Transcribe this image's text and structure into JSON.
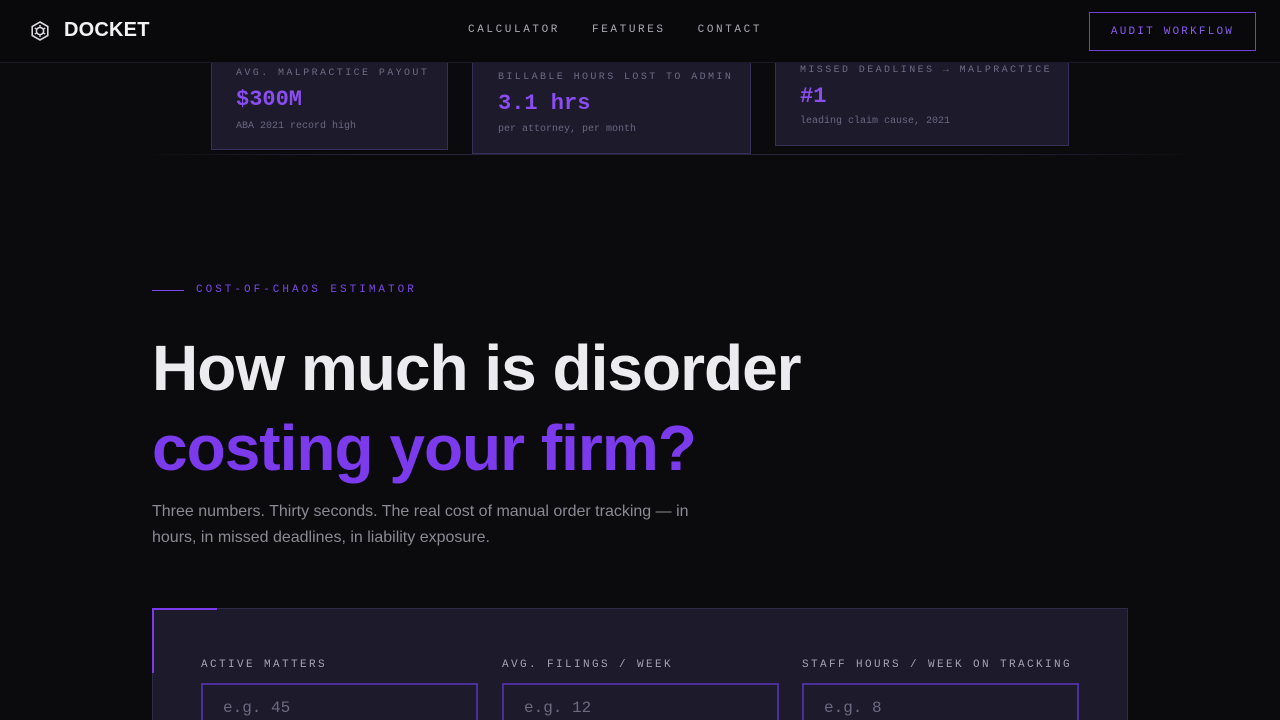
{
  "nav": {
    "brand": "DOCKET",
    "brand_icon": "gear-logo-icon",
    "links": [
      "CALCULATOR",
      "FEATURES",
      "CONTACT"
    ],
    "cta": "AUDIT WORKFLOW"
  },
  "stats": [
    {
      "label": "AVG. MALPRACTICE PAYOUT",
      "value": "$300M",
      "sub": "ABA 2021 record high"
    },
    {
      "label": "BILLABLE HOURS LOST TO ADMIN",
      "value": "3.1 hrs",
      "sub": "per attorney, per month"
    },
    {
      "label": "MISSED DEADLINES → MALPRACTICE",
      "value": "#1",
      "sub": "leading claim cause, 2021"
    }
  ],
  "hero": {
    "eyebrow": "COST-OF-CHAOS ESTIMATOR",
    "title_line1": "How much is disorder",
    "title_line2": "costing your firm?",
    "lead": "Three numbers. Thirty seconds. The real cost of manual order tracking — in hours, in missed deadlines, in liability exposure."
  },
  "calculator": {
    "fields": [
      {
        "label": "ACTIVE MATTERS",
        "placeholder": "e.g. 45",
        "value": ""
      },
      {
        "label": "AVG. FILINGS / WEEK",
        "placeholder": "e.g. 12",
        "value": ""
      },
      {
        "label": "STAFF HOURS / WEEK ON TRACKING",
        "placeholder": "e.g. 8",
        "value": ""
      }
    ]
  },
  "colors": {
    "accent": "#7c3aed",
    "background": "#0b0b0e",
    "card": "#1c1a2b"
  }
}
